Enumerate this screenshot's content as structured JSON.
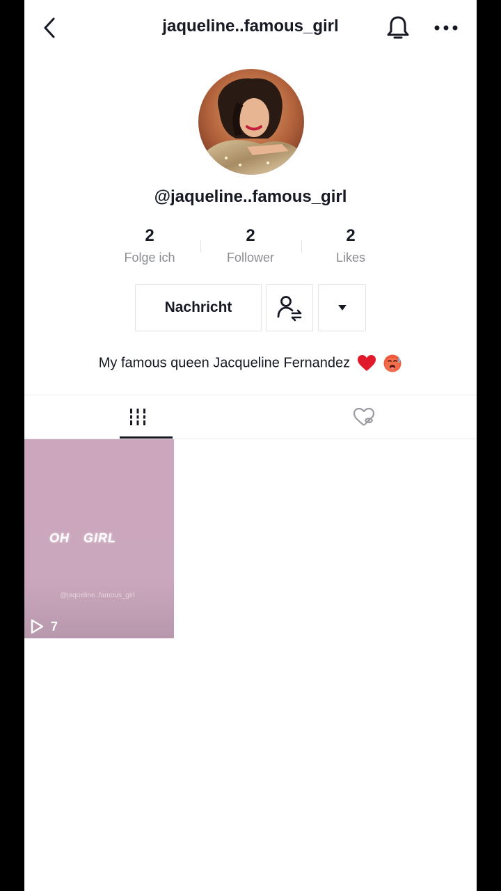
{
  "header": {
    "title": "jaqueline..famous_girl",
    "back_icon": "chevron-left-icon",
    "bell_icon": "bell-icon",
    "more_icon": "more-horizontal-icon"
  },
  "profile": {
    "username": "@jaqueline..famous_girl",
    "avatar": "profile-photo",
    "stats": [
      {
        "value": "2",
        "label": "Folge ich"
      },
      {
        "value": "2",
        "label": "Follower"
      },
      {
        "value": "2",
        "label": "Likes"
      }
    ],
    "message_button": "Nachricht",
    "bio": "My famous queen Jacqueline Fernandez",
    "bio_emojis": [
      "red-heart-icon",
      "hot-face-emoji-icon"
    ]
  },
  "tabs": [
    {
      "icon": "grid-icon",
      "active": true
    },
    {
      "icon": "hidden-heart-icon",
      "active": false
    }
  ],
  "videos": [
    {
      "text": "OH GIRL",
      "watermark": "@jaqueline..famous_girl",
      "views": "7"
    }
  ],
  "colors": {
    "text": "#161823",
    "secondary": "#8a8b91",
    "border": "#e3e3e4",
    "tile": "#cba7bd",
    "heart": "#e0192b"
  }
}
